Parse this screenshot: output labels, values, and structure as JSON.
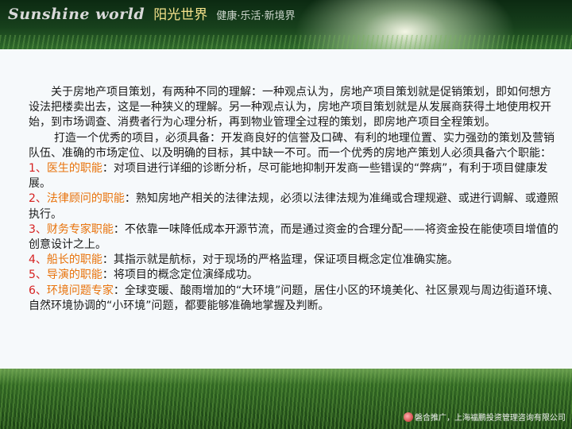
{
  "header": {
    "brand_en": "Sunshine world",
    "brand_cn": "阳光世界",
    "slogan": "健康·乐活·新境界"
  },
  "body": {
    "intro1": "关于房地产项目策划，有两种不同的理解：一种观点认为，房地产项目策划就是促销策划，即如何想方设法把楼卖出去，这是一种狭义的理解。另一种观点认为，房地产项目策划就是从发展商获得土地使用权开始，到市场调查、消费者行为心理分析，再到物业管理全过程的策划，即房地产项目全程策划。",
    "intro2": "打造一个优秀的项目，必须具备：开发商良好的信誉及口碑、有利的地理位置、实力强劲的策划及营销队伍、准确的市场定位、以及明确的目标，其中缺一不可。而一个优秀的房地产策划人必须具备六个职能：",
    "items": [
      {
        "num": "1、",
        "title": "医生的职能",
        "colon": "：",
        "desc": "对项目进行详细的诊断分析，尽可能地抑制开发商一些错误的“弊病”，有利于项目健康发展。"
      },
      {
        "num": "2、",
        "title": "法律顾问的职能",
        "colon": "：",
        "desc": "熟知房地产相关的法律法规，必须以法律法规为准绳或合理规避、或进行调解、或遵照执行。"
      },
      {
        "num": "3、",
        "title": "财务专家职能",
        "colon": "：",
        "desc": "不依靠一味降低成本开源节流，而是通过资金的合理分配——将资金投在能使项目增值的创意设计之上。"
      },
      {
        "num": "4、",
        "title": "船长的职能",
        "colon": "：",
        "desc": "其指示就是航标，对于现场的严格监理，保证项目概念定位准确实施。"
      },
      {
        "num": "5、",
        "title": "导演的职能",
        "colon": "：",
        "desc": "将项目的概念定位演绎成功。"
      },
      {
        "num": "6、",
        "title": "环境问题专家",
        "colon": "：",
        "desc": "全球变暖、酸雨增加的“大环境”问题，居住小区的环境美化、社区景观与周边街道环境、自然环境协调的“小环境”问题，都要能够准确地掌握及判断。"
      }
    ]
  },
  "footer": {
    "credit": "磐合推广，上海福鹏投资管理咨询有限公司"
  },
  "colors": {
    "number": "#d62020",
    "title": "#e8730c",
    "text": "#1a1a1a"
  },
  "icons": [
    "company-logo-icon"
  ]
}
